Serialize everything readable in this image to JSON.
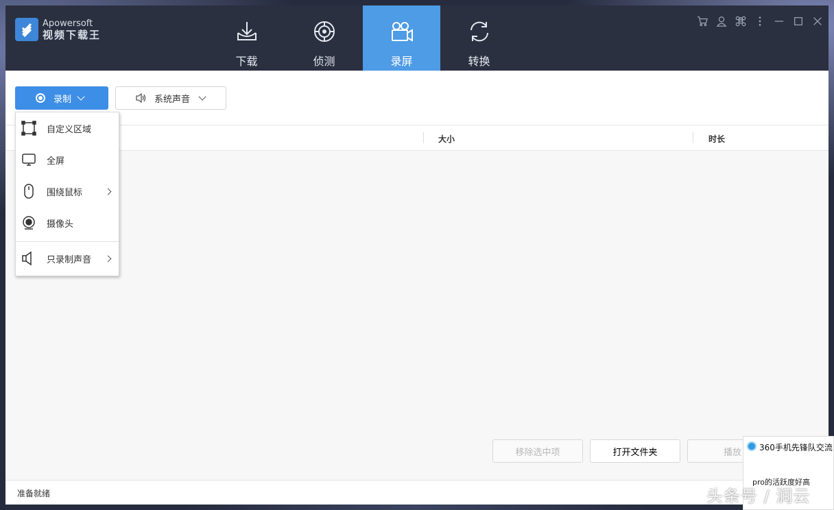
{
  "app": {
    "brand": "Apowersoft",
    "name": "视频下载王"
  },
  "nav": {
    "items": [
      {
        "label": "下载",
        "icon": "download-icon"
      },
      {
        "label": "侦测",
        "icon": "detect-icon"
      },
      {
        "label": "录屏",
        "icon": "video-camera-icon",
        "active": true
      },
      {
        "label": "转换",
        "icon": "convert-icon"
      }
    ]
  },
  "window_controls": [
    "cart-icon",
    "user-icon",
    "command-icon",
    "more-icon",
    "minimize-icon",
    "maximize-icon",
    "close-icon"
  ],
  "toolbar": {
    "record_label": "录制",
    "sound_label": "系统声音"
  },
  "table": {
    "columns": [
      "大小",
      "时长"
    ]
  },
  "dropdown": {
    "items": [
      {
        "label": "自定义区域",
        "icon": "custom-region-icon",
        "submenu": false
      },
      {
        "label": "全屏",
        "icon": "monitor-icon",
        "submenu": false
      },
      {
        "label": "围绕鼠标",
        "icon": "mouse-icon",
        "submenu": true
      },
      {
        "label": "摄像头",
        "icon": "webcam-icon",
        "submenu": false
      },
      {
        "label": "只录制声音",
        "icon": "speaker-icon",
        "submenu": true
      }
    ]
  },
  "actions": {
    "remove_label": "移除选中项",
    "open_folder_label": "打开文件夹",
    "play_label": "播放"
  },
  "status": {
    "text": "准备就绪"
  },
  "notification": {
    "title": "360手机先锋队交流",
    "message": "pro的活跃度好高"
  },
  "watermark": "头条号 / 润云",
  "colors": {
    "accent": "#4e9be6",
    "titlebar": "#2a3040",
    "record_button": "#3d8ee6"
  }
}
